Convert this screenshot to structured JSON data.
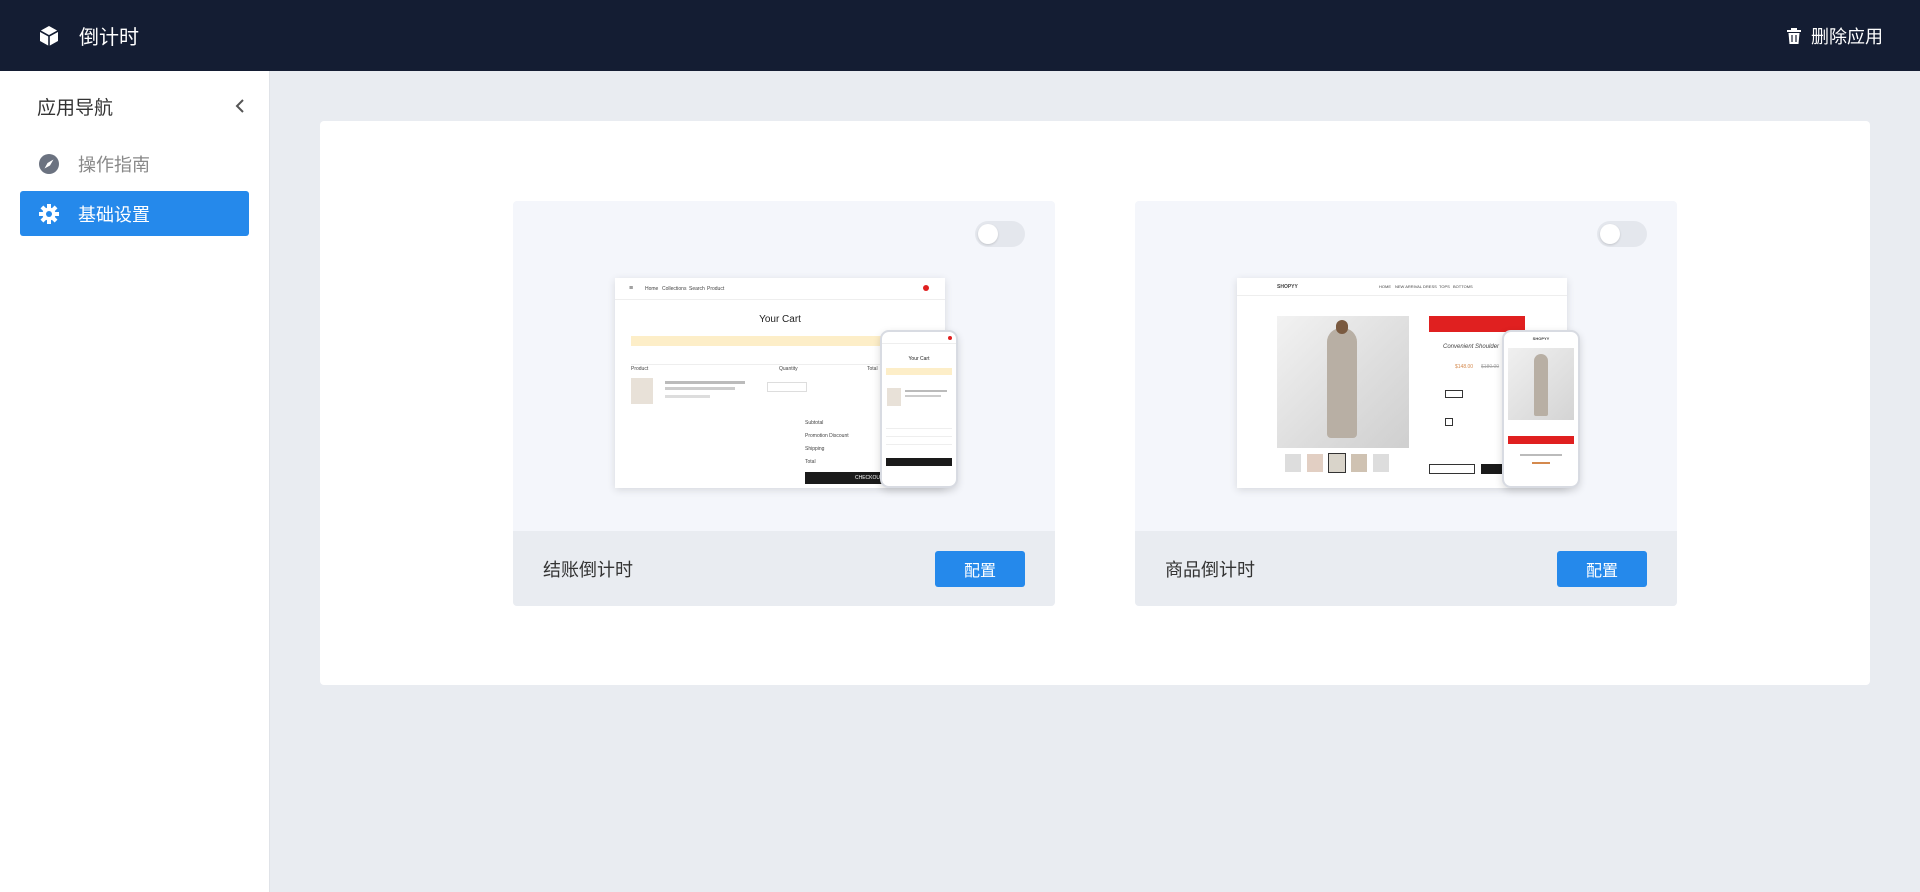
{
  "app": {
    "title": "倒计时",
    "logo_icon": "cube-icon"
  },
  "header": {
    "delete_label": "删除应用",
    "delete_icon": "trash-icon"
  },
  "sidebar": {
    "heading": "应用导航",
    "collapse_icon": "chevron-left-icon",
    "items": [
      {
        "label": "操作指南",
        "icon": "compass-icon",
        "active": false
      },
      {
        "label": "基础设置",
        "icon": "gear-icon",
        "active": true
      }
    ]
  },
  "features": [
    {
      "title": "结账倒计时",
      "button_label": "配置",
      "enabled": false,
      "preview": {
        "nav": [
          "Home",
          "Collections",
          "Search",
          "Product"
        ],
        "page_title": "Your Cart",
        "columns": [
          "Product",
          "Quantity",
          "Total"
        ],
        "rows": [
          "Subtotal",
          "Promotion Discount",
          "Shipping",
          "Total"
        ],
        "checkout": "CHECKOUT",
        "phone_title": "Your Cart"
      }
    },
    {
      "title": "商品倒计时",
      "button_label": "配置",
      "enabled": false,
      "preview": {
        "logo": "SHOPYY",
        "nav": [
          "HOME",
          "NEW ARRIVAL",
          "DRESS",
          "TOPS",
          "BOTTOMS"
        ],
        "product_name": "Convenient Shoulder",
        "price": "$148.00",
        "old_price": "$180.00",
        "phone_logo": "SHOPYY"
      }
    }
  ],
  "colors": {
    "primary": "#2589eb",
    "topbar": "#141d33",
    "bg": "#e9ecf1",
    "accent_red": "#e02020"
  }
}
